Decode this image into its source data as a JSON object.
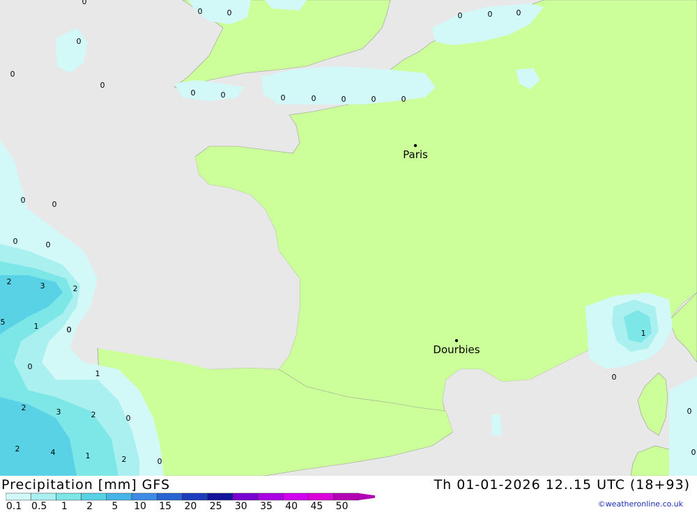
{
  "map": {
    "cities": [
      {
        "name": "Paris"
      },
      {
        "name": "Dourbies"
      }
    ],
    "precip_labels": [
      "0",
      "0",
      "0",
      "0",
      "0",
      "0",
      "0",
      "0",
      "0",
      "0",
      "0",
      "0",
      "0",
      "0",
      "0",
      "0",
      "0",
      "0",
      "0",
      "0",
      "0",
      "2",
      "3",
      "2",
      "5",
      "1",
      "0",
      "0",
      "1",
      "2",
      "3",
      "2",
      "0",
      "2",
      "4",
      "1",
      "2",
      "0",
      "1",
      "0",
      "0",
      "0"
    ]
  },
  "footer": {
    "title": "Precipitation [mm] GFS",
    "timestamp": "Th 01-01-2026 12..15 UTC (18+93)",
    "credit": "©weatheronline.co.uk",
    "legend": {
      "labels": [
        "0.1",
        "0.5",
        "1",
        "2",
        "5",
        "10",
        "15",
        "20",
        "25",
        "30",
        "35",
        "40",
        "45",
        "50"
      ],
      "colors": [
        "#d2f8f8",
        "#aaf0f0",
        "#7de6e6",
        "#5ad2e6",
        "#46b4e6",
        "#3c8ce6",
        "#2864d2",
        "#1e3cbe",
        "#14149b",
        "#7800d2",
        "#aa00e6",
        "#d200f0",
        "#dc00dc",
        "#b400b4"
      ]
    }
  }
}
